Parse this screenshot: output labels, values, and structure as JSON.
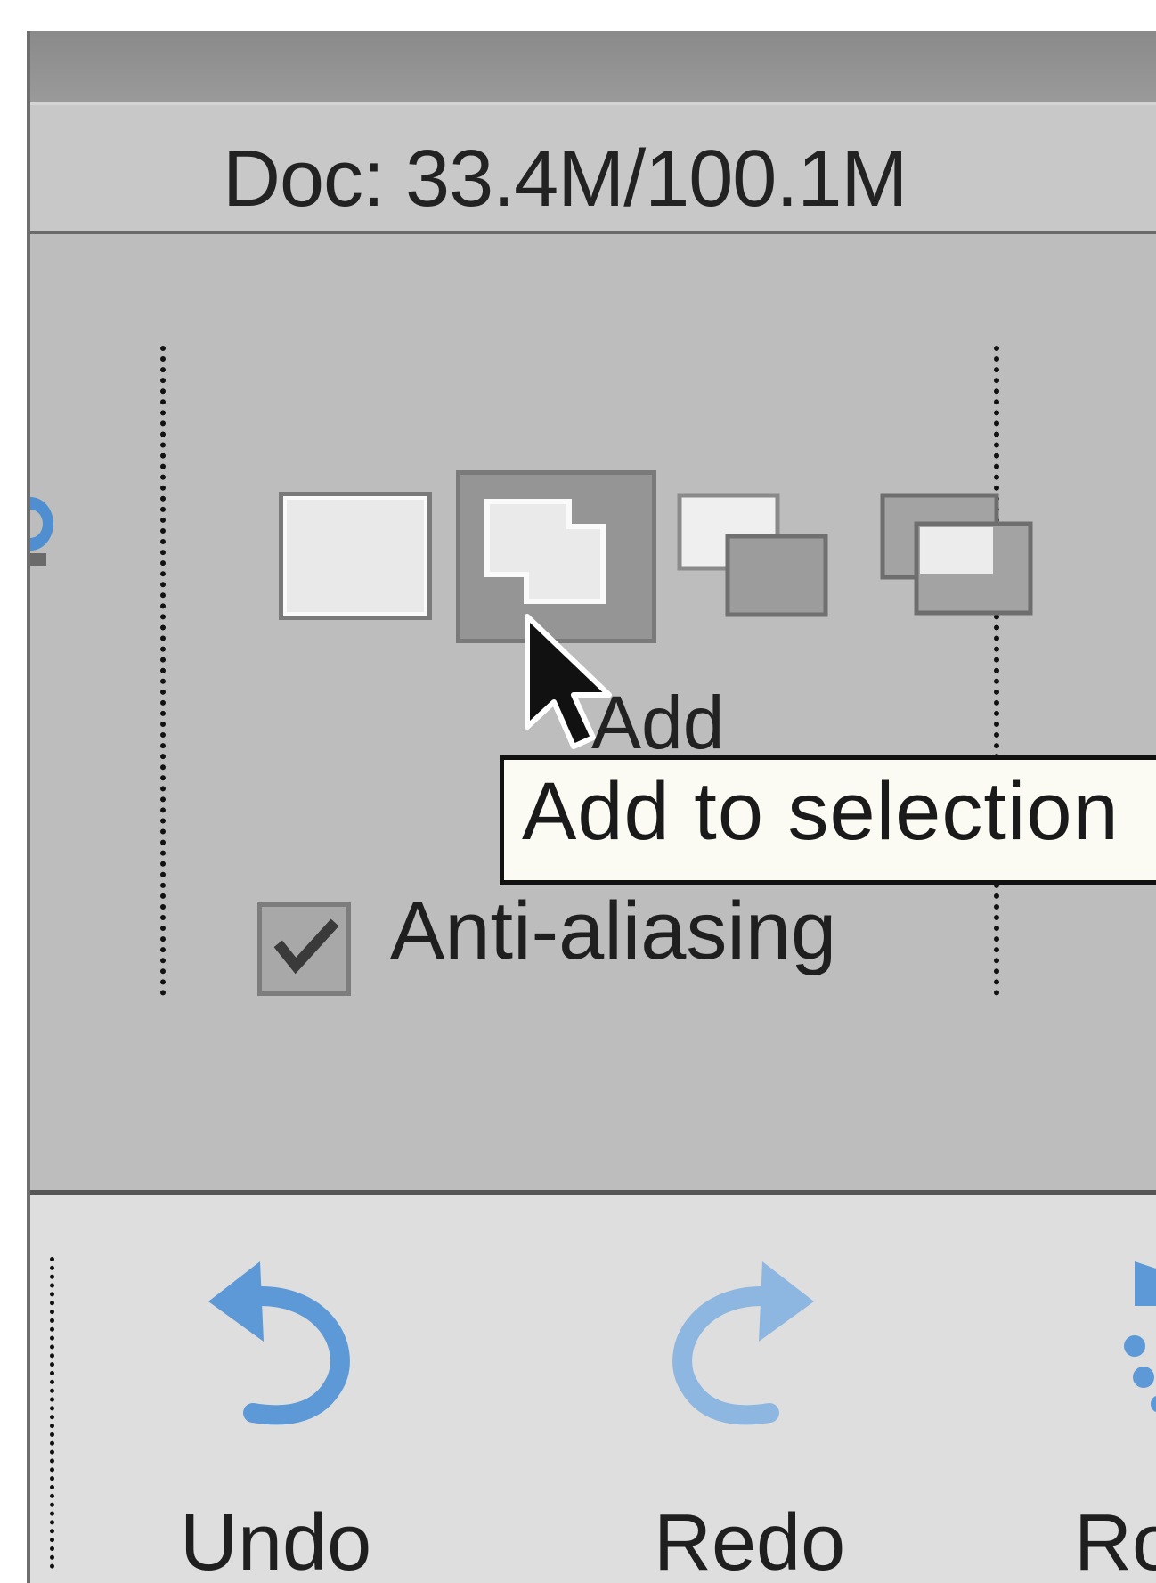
{
  "status_bar": {
    "doc_info": "Doc: 33.4M/100.1M"
  },
  "tool_options": {
    "selection_modes": [
      {
        "name": "new",
        "icon": "new-selection-icon",
        "selected": false
      },
      {
        "name": "add",
        "icon": "add-selection-icon",
        "selected": true
      },
      {
        "name": "subtract",
        "icon": "subtract-selection-icon",
        "selected": false
      },
      {
        "name": "intersect",
        "icon": "intersect-selection-icon",
        "selected": false
      }
    ],
    "mode_caption": "Add",
    "tooltip": "Add to selection",
    "anti_aliasing": {
      "label": "Anti-aliasing",
      "checked": true
    }
  },
  "action_bar": {
    "undo_label": "Undo",
    "redo_label": "Redo",
    "rotate_label_partial": "Ro"
  },
  "colors": {
    "panel_bg": "#bdbdbd",
    "action_bar_bg": "#dedede",
    "accent_blue": "#5b9bd5",
    "tooltip_bg": "#fbfbf4"
  }
}
